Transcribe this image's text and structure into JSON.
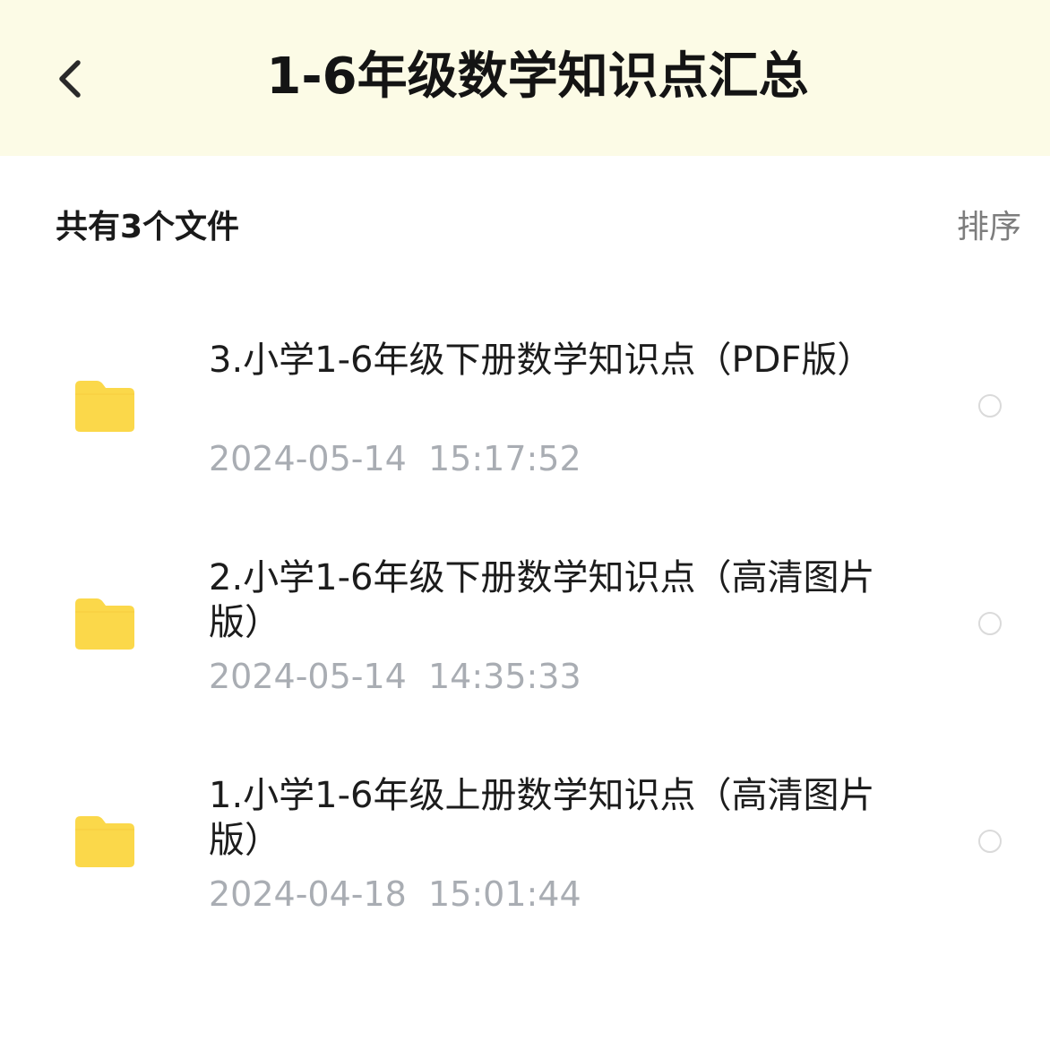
{
  "header": {
    "title": "1-6年级数学知识点汇总",
    "back_icon": "chevron-left-icon",
    "background": "#fcfbe6"
  },
  "list_header": {
    "count_label": "共有3个文件",
    "sort_label": "排序"
  },
  "files": [
    {
      "name": "3.小学1-6年级下册数学知识点（PDF版）",
      "modified": "2024-05-14  15:17:52",
      "icon": "folder-icon",
      "selected": false
    },
    {
      "name": "2.小学1-6年级下册数学知识点（高清图片版）",
      "modified": "2024-05-14  14:35:33",
      "icon": "folder-icon",
      "selected": false
    },
    {
      "name": "1.小学1-6年级上册数学知识点（高清图片版）",
      "modified": "2024-04-18  15:01:44",
      "icon": "folder-icon",
      "selected": false
    }
  ],
  "colors": {
    "folder": "#fbd84a",
    "date_text": "#a9adb3",
    "radio_border": "#dadada"
  }
}
